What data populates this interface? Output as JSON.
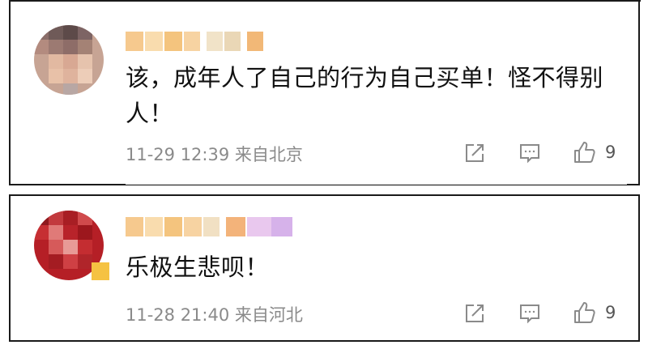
{
  "comments": [
    {
      "text": "该，成年人了自己的行为自己买单！怪不得别人！",
      "time": "11-29 12:39",
      "location": "来自北京",
      "likes": "9"
    },
    {
      "text": "乐极生悲呗！",
      "time": "11-28 21:40",
      "location": "来自河北",
      "likes": "9"
    }
  ],
  "colors": {
    "meta": "#8a8a8a",
    "text": "#111111",
    "icon": "#8a8a8a",
    "border": "#1a1a1a"
  }
}
